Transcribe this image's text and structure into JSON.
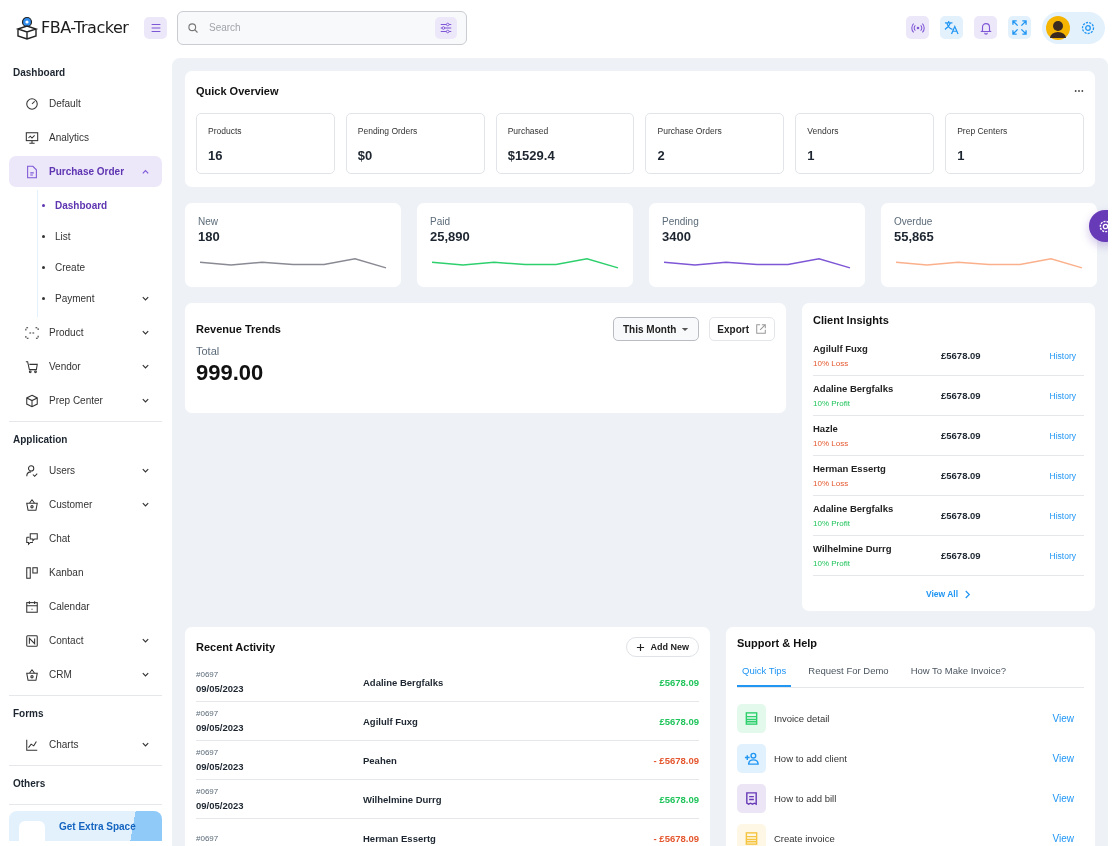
{
  "brand": {
    "name": "FBA-Tracker"
  },
  "search": {
    "placeholder": "Search"
  },
  "sidebar": {
    "sections": [
      {
        "title": "Dashboard",
        "items": [
          {
            "label": "Default",
            "has_children": false,
            "selected": false
          },
          {
            "label": "Analytics",
            "has_children": false,
            "selected": false
          },
          {
            "label": "Purchase Order",
            "has_children": true,
            "expanded": true,
            "selected": true,
            "children": [
              {
                "label": "Dashboard",
                "has_children": false,
                "selected": true
              },
              {
                "label": "List",
                "has_children": false,
                "selected": false
              },
              {
                "label": "Create",
                "has_children": false,
                "selected": false
              },
              {
                "label": "Payment",
                "has_children": true,
                "selected": false
              }
            ]
          },
          {
            "label": "Product",
            "has_children": true,
            "expanded": false,
            "selected": false
          },
          {
            "label": "Vendor",
            "has_children": true,
            "expanded": false,
            "selected": false
          },
          {
            "label": "Prep Center",
            "has_children": true,
            "expanded": false,
            "selected": false
          }
        ]
      },
      {
        "title": "Application",
        "items": [
          {
            "label": "Users",
            "has_children": true,
            "expanded": false,
            "selected": false
          },
          {
            "label": "Customer",
            "has_children": true,
            "expanded": false,
            "selected": false
          },
          {
            "label": "Chat",
            "has_children": false,
            "selected": false
          },
          {
            "label": "Kanban",
            "has_children": false,
            "selected": false
          },
          {
            "label": "Calendar",
            "has_children": false,
            "selected": false
          },
          {
            "label": "Contact",
            "has_children": true,
            "expanded": false,
            "selected": false
          },
          {
            "label": "CRM",
            "has_children": true,
            "expanded": false,
            "selected": false
          }
        ]
      },
      {
        "title": "Forms",
        "items": [
          {
            "label": "Charts",
            "has_children": true,
            "expanded": false,
            "selected": false
          }
        ]
      },
      {
        "title": "Others"
      }
    ],
    "promo": {
      "title": "Get Extra Space"
    }
  },
  "quick_overview": {
    "title": "Quick Overview",
    "stats": [
      {
        "label": "Products",
        "value": "16"
      },
      {
        "label": "Pending Orders",
        "value": "$0"
      },
      {
        "label": "Purchased",
        "value": "$1529.4"
      },
      {
        "label": "Purchase Orders",
        "value": "2"
      },
      {
        "label": "Vendors",
        "value": "1"
      },
      {
        "label": "Prep Centers",
        "value": "1"
      }
    ]
  },
  "status_cards": [
    {
      "label": "New",
      "value": "180",
      "color": "#8a8a94"
    },
    {
      "label": "Paid",
      "value": "25,890",
      "color": "#2ed06e"
    },
    {
      "label": "Pending",
      "value": "3400",
      "color": "#7e57d6"
    },
    {
      "label": "Overdue",
      "value": "55,865",
      "color": "#fbb08c"
    }
  ],
  "revenue": {
    "title": "Revenue Trends",
    "period": "This Month",
    "export": "Export",
    "total_label": "Total",
    "total": "999.00"
  },
  "client_insights": {
    "title": "Client Insights",
    "link": "View All",
    "rows": [
      {
        "name": "Agilulf Fuxg",
        "change": "10% Loss",
        "kind": "loss",
        "amount": "£5678.09",
        "action": "History"
      },
      {
        "name": "Adaline Bergfalks",
        "change": "10% Profit",
        "kind": "profit",
        "amount": "£5678.09",
        "action": "History"
      },
      {
        "name": "Hazle",
        "change": "10% Loss",
        "kind": "loss",
        "amount": "£5678.09",
        "action": "History"
      },
      {
        "name": "Herman Essertg",
        "change": "10% Loss",
        "kind": "loss",
        "amount": "£5678.09",
        "action": "History"
      },
      {
        "name": "Adaline Bergfalks",
        "change": "10% Profit",
        "kind": "profit",
        "amount": "£5678.09",
        "action": "History"
      },
      {
        "name": "Wilhelmine Durrg",
        "change": "10% Profit",
        "kind": "profit",
        "amount": "£5678.09",
        "action": "History"
      }
    ]
  },
  "recent_activity": {
    "title": "Recent Activity",
    "add": "Add New",
    "rows": [
      {
        "id": "#0697",
        "date": "09/05/2023",
        "name": "Adaline Bergfalks",
        "amount": "£5678.09",
        "kind": "credit"
      },
      {
        "id": "#0697",
        "date": "09/05/2023",
        "name": "Agilulf Fuxg",
        "amount": "£5678.09",
        "kind": "credit"
      },
      {
        "id": "#0697",
        "date": "09/05/2023",
        "name": "Peahen",
        "amount": "- £5678.09",
        "kind": "debit"
      },
      {
        "id": "#0697",
        "date": "09/05/2023",
        "name": "Wilhelmine Durrg",
        "amount": "£5678.09",
        "kind": "credit"
      },
      {
        "id": "#0697",
        "name": "Herman Essertg",
        "amount": "- £5678.09",
        "kind": "debit"
      }
    ]
  },
  "support": {
    "title": "Support & Help",
    "tabs": [
      {
        "label": "Quick Tips",
        "selected": true
      },
      {
        "label": "Request For Demo",
        "selected": false
      },
      {
        "label": "How To Make Invoice?",
        "selected": false
      }
    ],
    "tips": [
      {
        "label": "Invoice detail",
        "color": "#2ed06e",
        "action": "View"
      },
      {
        "label": "How to add client",
        "color": "#2196f3",
        "action": "View"
      },
      {
        "label": "How to add bill",
        "color": "#673ab7",
        "action": "View"
      },
      {
        "label": "Create invoice",
        "color": "#f5c542",
        "action": "View"
      }
    ]
  }
}
